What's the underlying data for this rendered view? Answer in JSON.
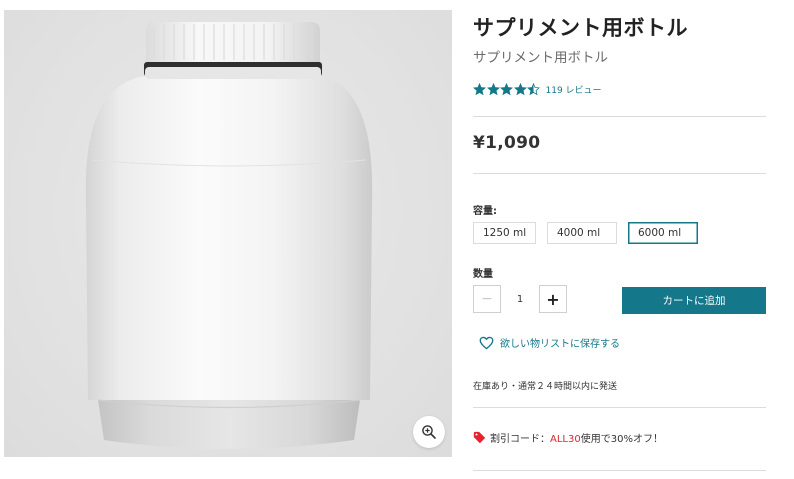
{
  "product": {
    "title": "サプリメント用ボトル",
    "subtitle": "サプリメント用ボトル",
    "rating": 4.5,
    "rating_max": 5,
    "review_count_label": "119 レビュー",
    "price": "¥1,090",
    "capacity_label": "容量:",
    "capacity_options": [
      "1250 ml",
      "4000 ml",
      "6000 ml"
    ],
    "selected_capacity": "6000 ml",
    "quantity_label": "数量",
    "quantity_value": "1",
    "add_to_cart_label": "カートに追加",
    "wishlist_label": "欲しい物リストに保存する",
    "stock_text": "在庫あり・通常２４時間以内に発送",
    "discount": {
      "prefix": "割引コード：",
      "code": "ALL30",
      "suffix": "使用で30%オフ！"
    }
  },
  "colors": {
    "accent": "#14788a",
    "star": "#14788a",
    "discount_code": "#e4232f",
    "tag_icon": "#e4232f",
    "image_background": "#e4e4e4"
  },
  "icons": {
    "zoom": "zoom-in-icon",
    "wishlist": "heart-icon",
    "discount": "tag-icon",
    "star": "star-icon"
  }
}
